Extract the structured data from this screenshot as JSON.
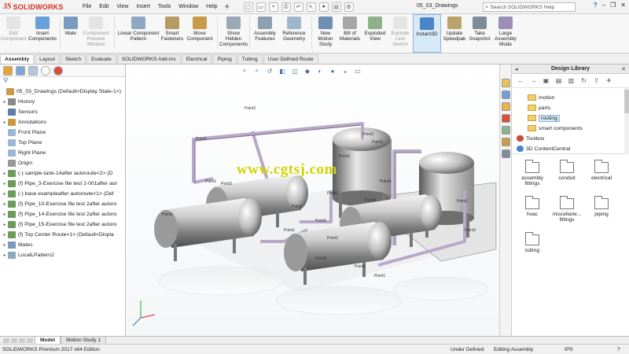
{
  "app": {
    "brand": "SOLIDWORKS",
    "menus": [
      "File",
      "Edit",
      "View",
      "Insert",
      "Tools",
      "Window",
      "Help"
    ],
    "doc_title": "05_03_Drawings",
    "search_placeholder": "Search SOLIDWORKS Help"
  },
  "commands": [
    {
      "label": "Edit Component",
      "disabled": true,
      "color": "#c8c8c8"
    },
    {
      "label": "Insert Components",
      "disabled": false,
      "color": "#6aa0d8"
    },
    {
      "label": "Mate",
      "disabled": false,
      "color": "#7a9bbf"
    },
    {
      "label": "Component Preview Window",
      "disabled": true,
      "color": "#c8c8c8"
    },
    {
      "label": "Linear Component Pattern",
      "disabled": false,
      "color": "#8fa8c2"
    },
    {
      "label": "Smart Fasteners",
      "disabled": false,
      "color": "#b59a62"
    },
    {
      "label": "Move Component",
      "disabled": false,
      "color": "#c89b4a"
    },
    {
      "label": "Show Hidden Components",
      "disabled": false,
      "color": "#9aa7b4"
    },
    {
      "label": "Assembly Features",
      "disabled": false,
      "color": "#8e9fb0"
    },
    {
      "label": "Reference Geometry",
      "disabled": false,
      "color": "#9fb7cc"
    },
    {
      "label": "New Motion Study",
      "disabled": false,
      "color": "#6d8fb2"
    },
    {
      "label": "Bill of Materials",
      "disabled": false,
      "color": "#a6a6a6"
    },
    {
      "label": "Exploded View",
      "disabled": false,
      "color": "#8fb18a"
    },
    {
      "label": "Explode Line Sketch",
      "disabled": true,
      "color": "#c8c8c8"
    },
    {
      "label": "Instant3D",
      "disabled": false,
      "color": "#4a86c5",
      "active": true
    },
    {
      "label": "Update Speedpak",
      "disabled": false,
      "color": "#b9a36b"
    },
    {
      "label": "Take Snapshot",
      "disabled": false,
      "color": "#7f8b97"
    },
    {
      "label": "Large Assembly Mode",
      "disabled": false,
      "color": "#9b8fb8"
    }
  ],
  "tabs": [
    "Assembly",
    "Layout",
    "Sketch",
    "Evaluate",
    "SOLIDWORKS Add-Ins",
    "Electrical",
    "Piping",
    "Tubing",
    "User Defined Route"
  ],
  "feature_tree": {
    "root": "05_03_Drawings  (Default<Display State-1>)",
    "items": [
      {
        "label": "History",
        "color": "#8a8a8a",
        "exp": "▸"
      },
      {
        "label": "Sensors",
        "color": "#5b7fa8",
        "exp": ""
      },
      {
        "label": "Annotations",
        "color": "#c99a3f",
        "exp": "▸"
      },
      {
        "label": "Front Plane",
        "color": "#9db7d3",
        "exp": ""
      },
      {
        "label": "Top Plane",
        "color": "#9db7d3",
        "exp": ""
      },
      {
        "label": "Right Plane",
        "color": "#9db7d3",
        "exp": ""
      },
      {
        "label": "Origin",
        "color": "#999999",
        "exp": ""
      },
      {
        "label": "(-) sample-tank-14after autoroute<2> (D",
        "color": "#6b9c5a",
        "exp": "▸"
      },
      {
        "label": "(f) Pipe_3-Exercise file test 2-001after aut",
        "color": "#6b9c5a",
        "exp": "▸"
      },
      {
        "label": "(-) base exampleafter autoroute<1> (Def",
        "color": "#6b9c5a",
        "exp": "▸"
      },
      {
        "label": "(f) Pipe_10-Exercise file test 2after autoro",
        "color": "#6b9c5a",
        "exp": "▸"
      },
      {
        "label": "(f) Pipe_14-Exercise file test 2after autoro",
        "color": "#6b9c5a",
        "exp": "▸"
      },
      {
        "label": "(f) Pipe_15-Exercise file test 2after autoro",
        "color": "#6b9c5a",
        "exp": "▸"
      },
      {
        "label": "(f) Top Center Route<1> (Default<Displa",
        "color": "#6b9c5a",
        "exp": "▸"
      },
      {
        "label": "Mates",
        "color": "#7a9bbf",
        "exp": "▸"
      },
      {
        "label": "LocalLPattern2",
        "color": "#8fa8c2",
        "exp": "▸"
      }
    ]
  },
  "graphics": {
    "watermark": "www.cgtsj.com",
    "labels": [
      "Point2",
      "Point1",
      "Point2",
      "Point1",
      "Point2",
      "Point4",
      "Point1",
      "Point2",
      "Point1",
      "Point1",
      "Point1",
      "Point2",
      "Point4",
      "Point1",
      "Point1",
      "Point1",
      "Point2",
      "Point1",
      "Point1",
      "Point2"
    ]
  },
  "design_library": {
    "title": "Design Library",
    "tree": [
      {
        "label": "motion",
        "indent": 1
      },
      {
        "label": "parts",
        "indent": 1
      },
      {
        "label": "routing",
        "indent": 1,
        "selected": true
      },
      {
        "label": "smart components",
        "indent": 1
      },
      {
        "label": "Toolbox",
        "indent": 0
      },
      {
        "label": "3D ContentCentral",
        "indent": 0
      }
    ],
    "folders": [
      "assembly fittings",
      "conduit",
      "electrical",
      "hvac",
      "miscellane... fittings",
      "piping",
      "tubing"
    ]
  },
  "bottom_tabs": [
    "Model",
    "Motion Study 1"
  ],
  "status": {
    "edition": "SOLIDWORKS Premium 2017 x64 Edition",
    "state": "Under Defined",
    "mode": "Editing Assembly",
    "units": "IPS"
  }
}
